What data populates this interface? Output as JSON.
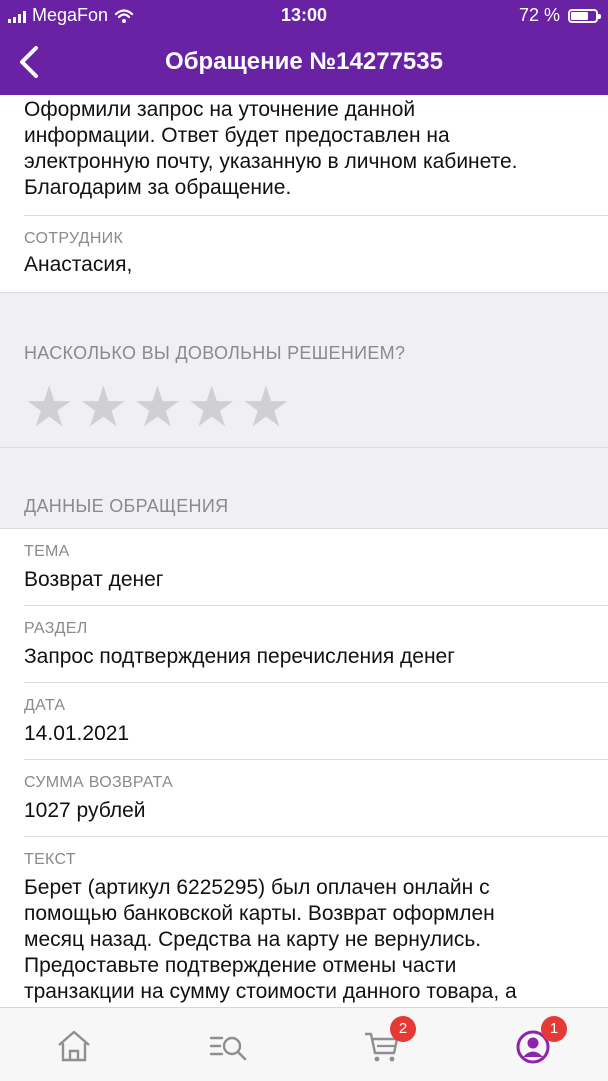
{
  "status_bar": {
    "carrier": "MegaFon",
    "time": "13:00",
    "battery": "72 %",
    "battery_level": 0.72
  },
  "header": {
    "title": "Обращение №14277535",
    "back_icon": "chevron-left-icon"
  },
  "message": {
    "text_lines": [
      "Оформили запрос на уточнение данной",
      "информации. Ответ будет предоставлен на",
      "электронную почту, указанную в личном кабинете.",
      "Благодарим за обращение."
    ]
  },
  "employee": {
    "label": "СОТРУДНИК",
    "value": "Анастасия,"
  },
  "rating": {
    "label": "НАСКОЛЬКО ВЫ ДОВОЛЬНЫ РЕШЕНИЕМ?",
    "stars_total": 5,
    "stars_selected": 0
  },
  "details": {
    "section_title": "ДАННЫЕ ОБРАЩЕНИЯ",
    "topic_label": "ТЕМА",
    "topic_value": "Возврат денег",
    "section_label": "РАЗДЕЛ",
    "section_value": "Запрос подтверждения перечисления денег",
    "date_label": "ДАТА",
    "date_value": "14.01.2021",
    "refund_label": "СУММА ВОЗВРАТА",
    "refund_value": "1027 рублей",
    "text_label": "ТЕКСТ",
    "text_lines": [
      "Берет (артикул 6225295) был оплачен онлайн с",
      "помощью банковской карты. Возврат оформлен",
      "месяц назад. Средства на карту не вернулись.",
      "Предоставьте подтверждение отмены части",
      "транзакции на сумму стоимости данного товара, а"
    ]
  },
  "tabbar": {
    "home_icon": "home-icon",
    "catalog_icon": "catalog-search-icon",
    "cart_icon": "cart-icon",
    "cart_badge": "2",
    "profile_icon": "profile-icon",
    "profile_badge": "1",
    "active_color": "#8e24aa"
  },
  "colors": {
    "brand": "#6a22a4",
    "badge": "#e53935",
    "section_bg": "#efeff4"
  }
}
